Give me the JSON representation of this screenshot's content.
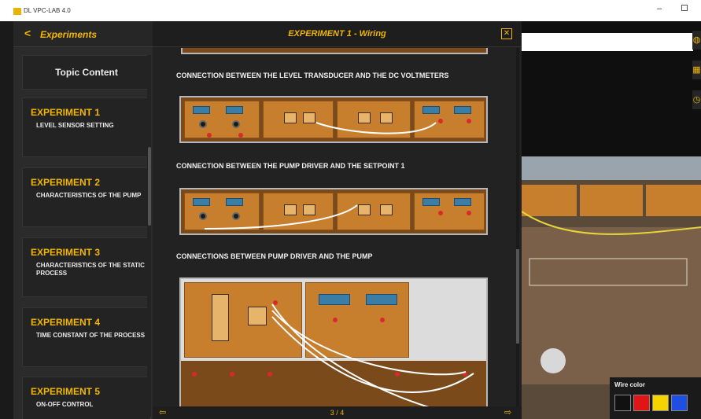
{
  "window": {
    "title": "DL VPC-LAB 4.0",
    "minimize_glyph": "–"
  },
  "sidebar": {
    "back_glyph": "<",
    "title": "Experiments",
    "topic_content": "Topic Content",
    "experiments": [
      {
        "title": "EXPERIMENT 1",
        "subtitle": "LEVEL SENSOR SETTING"
      },
      {
        "title": "EXPERIMENT 2",
        "subtitle": "CHARACTERISTICS OF THE PUMP"
      },
      {
        "title": "EXPERIMENT 3",
        "subtitle": "CHARACTERISTICS OF THE STATIC PROCESS"
      },
      {
        "title": "EXPERIMENT 4",
        "subtitle": "TIME CONSTANT OF THE PROCESS"
      },
      {
        "title": "EXPERIMENT 5",
        "subtitle": "ON-OFF CONTROL"
      }
    ]
  },
  "main": {
    "title": "EXPERIMENT 1 - Wiring",
    "close_glyph": "✕",
    "sections": [
      {
        "label": "CONNECTION BETWEEN THE LEVEL TRANSDUCER AND THE DC VOLTMETERS"
      },
      {
        "label": "CONNECTION BETWEEN THE PUMP DRIVER AND THE SETPOINT 1"
      },
      {
        "label": "CONNECTIONS BETWEEN PUMP DRIVER AND THE PUMP"
      }
    ],
    "page_indicator": "3 / 4",
    "prev_glyph": "⇦",
    "next_glyph": "⇨"
  },
  "viewport": {
    "wire_color_label": "Wire color",
    "wire_colors": [
      "#111111",
      "#e01515",
      "#f5d400",
      "#1f4fe0"
    ],
    "tool_icons": [
      "globe-icon",
      "grid-icon",
      "clock-icon"
    ]
  }
}
